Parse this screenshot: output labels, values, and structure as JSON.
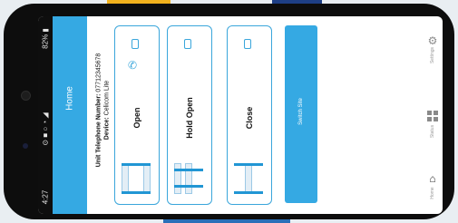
{
  "status_bar": {
    "time": "4:27",
    "icons": "⊙ ■  ○ ◔ ◢",
    "battery": "82% ▮"
  },
  "header": {
    "title": "Home"
  },
  "info": {
    "telephone_label": "Unit Telephone Number:",
    "telephone_value": "07712345678",
    "device_label": "Device:",
    "device_value": "Celicom Lite"
  },
  "actions": [
    {
      "label": "Open"
    },
    {
      "label": "Hold Open"
    },
    {
      "label": "Close"
    }
  ],
  "switch_site": {
    "label": "Switch Site"
  },
  "nav": {
    "settings_label": "Settings",
    "status_label": "Status",
    "home_label": "Home"
  },
  "colors": {
    "accent": "#35a9e3",
    "header_bg": "#35a9e3",
    "card_border": "#3aa6db"
  },
  "icons": {
    "phone": "mobile-phone-icon",
    "handset": "handset-icon",
    "gate": "gate-icon",
    "settings": "gear-icon",
    "status": "grid-icon",
    "home": "home-icon"
  }
}
